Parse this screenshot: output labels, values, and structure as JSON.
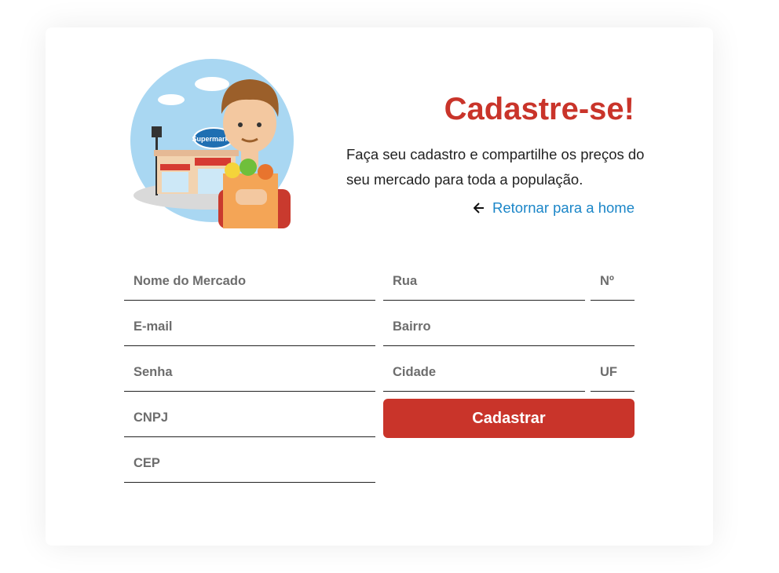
{
  "header": {
    "title": "Cadastre-se!",
    "description": "Faça seu cadastro e compartilhe os preços do seu mercado para toda a população.",
    "back_link": "Retornar para a home"
  },
  "illustration": {
    "store_sign": "Supermarket"
  },
  "form": {
    "market_name_placeholder": "Nome do Mercado",
    "email_placeholder": "E-mail",
    "password_placeholder": "Senha",
    "cnpj_placeholder": "CNPJ",
    "cep_placeholder": "CEP",
    "street_placeholder": "Rua",
    "number_placeholder": "Nº",
    "neighborhood_placeholder": "Bairro",
    "city_placeholder": "Cidade",
    "state_placeholder": "UF",
    "submit_label": "Cadastrar"
  },
  "colors": {
    "accent": "#c9342a",
    "link": "#1b86c8"
  }
}
